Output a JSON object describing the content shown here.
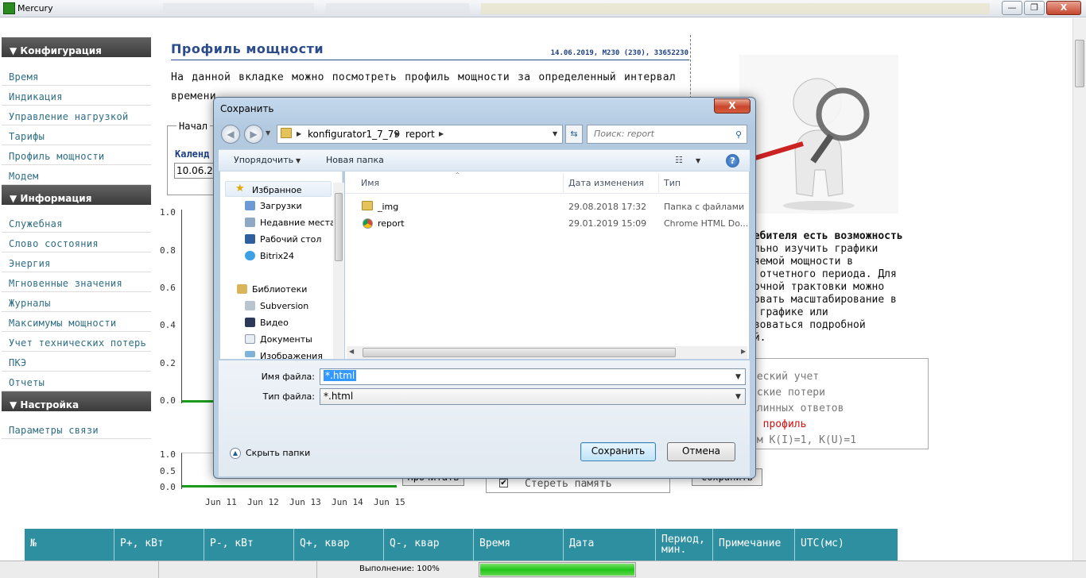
{
  "window": {
    "title": "Mercury",
    "minimize": "—",
    "maximize": "❐",
    "close": "X"
  },
  "sidebar": {
    "sections": [
      {
        "title": "▼ Конфигурация",
        "items": [
          "Время",
          "Индикация",
          "Управление нагрузкой",
          "Тарифы",
          "Профиль мощности",
          "Модем"
        ]
      },
      {
        "title": "▼ Информация",
        "items": [
          "Служебная",
          "Слово состояния",
          "Энергия",
          "Мгновенные значения",
          "Журналы",
          "Максимумы мощности",
          "Учет технических потерь",
          "ПКЭ",
          "Отчеты"
        ]
      },
      {
        "title": "▼ Настройка",
        "items": [
          "Параметры связи"
        ]
      }
    ]
  },
  "main": {
    "title": "Профиль мощности",
    "meta": "14.06.2019, M230 (230), 33652230",
    "description": "На данной вкладке можно посмотреть профиль мощности за определенный интервал времени.",
    "legend": "Начал",
    "calendar_label": "Календ",
    "calendar_value": "10.06.2019",
    "chart1_yticks": [
      "1.0",
      "0.8",
      "0.6",
      "0.4",
      "0.2",
      "0.0"
    ],
    "chart2_yticks": [
      "1.0",
      "0.5",
      "0.0"
    ],
    "chart2_xticks": [
      "Jun 11",
      "Jun 12",
      "Jun 13",
      "Jun 14",
      "Jun 15"
    ],
    "read_button": "Прочитать",
    "clear_memory": "Стереть память",
    "save_button": "Сохранить"
  },
  "right": {
    "text_lines": [
      "ребителя есть возможность",
      "ально изучить графики",
      "ляемой мощности в",
      "и отчетного периода. Для",
      "точной трактовки можно",
      "зовать масштабирование в",
      "й графике или",
      "ьзоваться подробной",
      "ей."
    ],
    "list": [
      "ческий учет",
      "еские потери",
      "длинных ответов",
      "й профиль",
      "ом K(I)=1, K(U)=1"
    ]
  },
  "table": {
    "headers": [
      "№",
      "P+, кВт",
      "P-, кВт",
      "Q+, квар",
      "Q-, квар",
      "Время",
      "Дата",
      "Период,\nмин.",
      "Примечание",
      "UTC(мс)"
    ]
  },
  "status": {
    "text": "Выполнение: 100%",
    "progress": 1.0
  },
  "dialog": {
    "title": "Сохранить",
    "close": "X",
    "path": [
      "konfigurator1_7_79",
      "report"
    ],
    "search_placeholder": "Поиск: report",
    "organize": "Упорядочить",
    "new_folder": "Новая папка",
    "help": "?",
    "tree": [
      {
        "label": "Избранное",
        "icon": "star-icon",
        "level": 0
      },
      {
        "label": "Загрузки",
        "icon": "downloads-icon",
        "level": 1
      },
      {
        "label": "Недавние места",
        "icon": "recent-places-icon",
        "level": 1
      },
      {
        "label": "Рабочий стол",
        "icon": "desktop-icon",
        "level": 1
      },
      {
        "label": "Bitrix24",
        "icon": "bitrix24-icon",
        "level": 1
      },
      {
        "label": "Библиотеки",
        "icon": "libraries-icon",
        "level": 0
      },
      {
        "label": "Subversion",
        "icon": "subversion-icon",
        "level": 1
      },
      {
        "label": "Видео",
        "icon": "video-icon",
        "level": 1
      },
      {
        "label": "Документы",
        "icon": "documents-icon",
        "level": 1
      },
      {
        "label": "Изображения",
        "icon": "pictures-icon",
        "level": 1
      }
    ],
    "columns": {
      "name": "Имя",
      "date": "Дата изменения",
      "type": "Тип"
    },
    "files": [
      {
        "name": "_img",
        "date": "29.08.2018 17:32",
        "type": "Папка с файлами",
        "icon": "folder-icon"
      },
      {
        "name": "report",
        "date": "29.01.2019 15:09",
        "type": "Chrome HTML Do...",
        "icon": "chrome-icon"
      }
    ],
    "filename_label": "Имя файла:",
    "filename_value": "*.html",
    "filetype_label": "Тип файла:",
    "filetype_value": "*.html",
    "hide_folders": "Скрыть папки",
    "save": "Сохранить",
    "cancel": "Отмена"
  }
}
